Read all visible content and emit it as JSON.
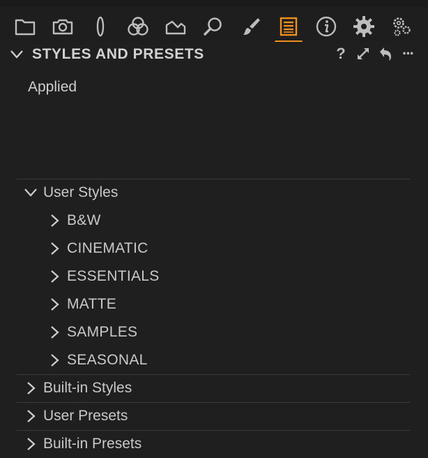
{
  "toolbar": {
    "tools": [
      {
        "icon": "folder-icon"
      },
      {
        "icon": "camera-icon"
      },
      {
        "icon": "lens-icon"
      },
      {
        "icon": "color-circles-icon"
      },
      {
        "icon": "exposure-histogram-icon"
      },
      {
        "icon": "magnifier-icon"
      },
      {
        "icon": "brush-icon"
      },
      {
        "icon": "styles-presets-icon",
        "active": true
      },
      {
        "icon": "info-icon"
      },
      {
        "icon": "gear-icon"
      },
      {
        "icon": "gears-icon"
      }
    ],
    "accent": "#f0901e"
  },
  "panel": {
    "title": "STYLES AND PRESETS",
    "header_icons": [
      "help-icon",
      "expand-icon",
      "undo-icon",
      "more-icon"
    ],
    "help_glyph": "?",
    "more_glyph": "···",
    "applied_label": "Applied"
  },
  "tree": {
    "user_styles": {
      "label": "User Styles",
      "expanded": true,
      "children": [
        "B&W",
        "CINEMATIC",
        "ESSENTIALS",
        "MATTE",
        "SAMPLES",
        "SEASONAL"
      ]
    },
    "built_in_styles": "Built-in Styles",
    "user_presets": "User Presets",
    "built_in_presets": "Built-in Presets"
  }
}
